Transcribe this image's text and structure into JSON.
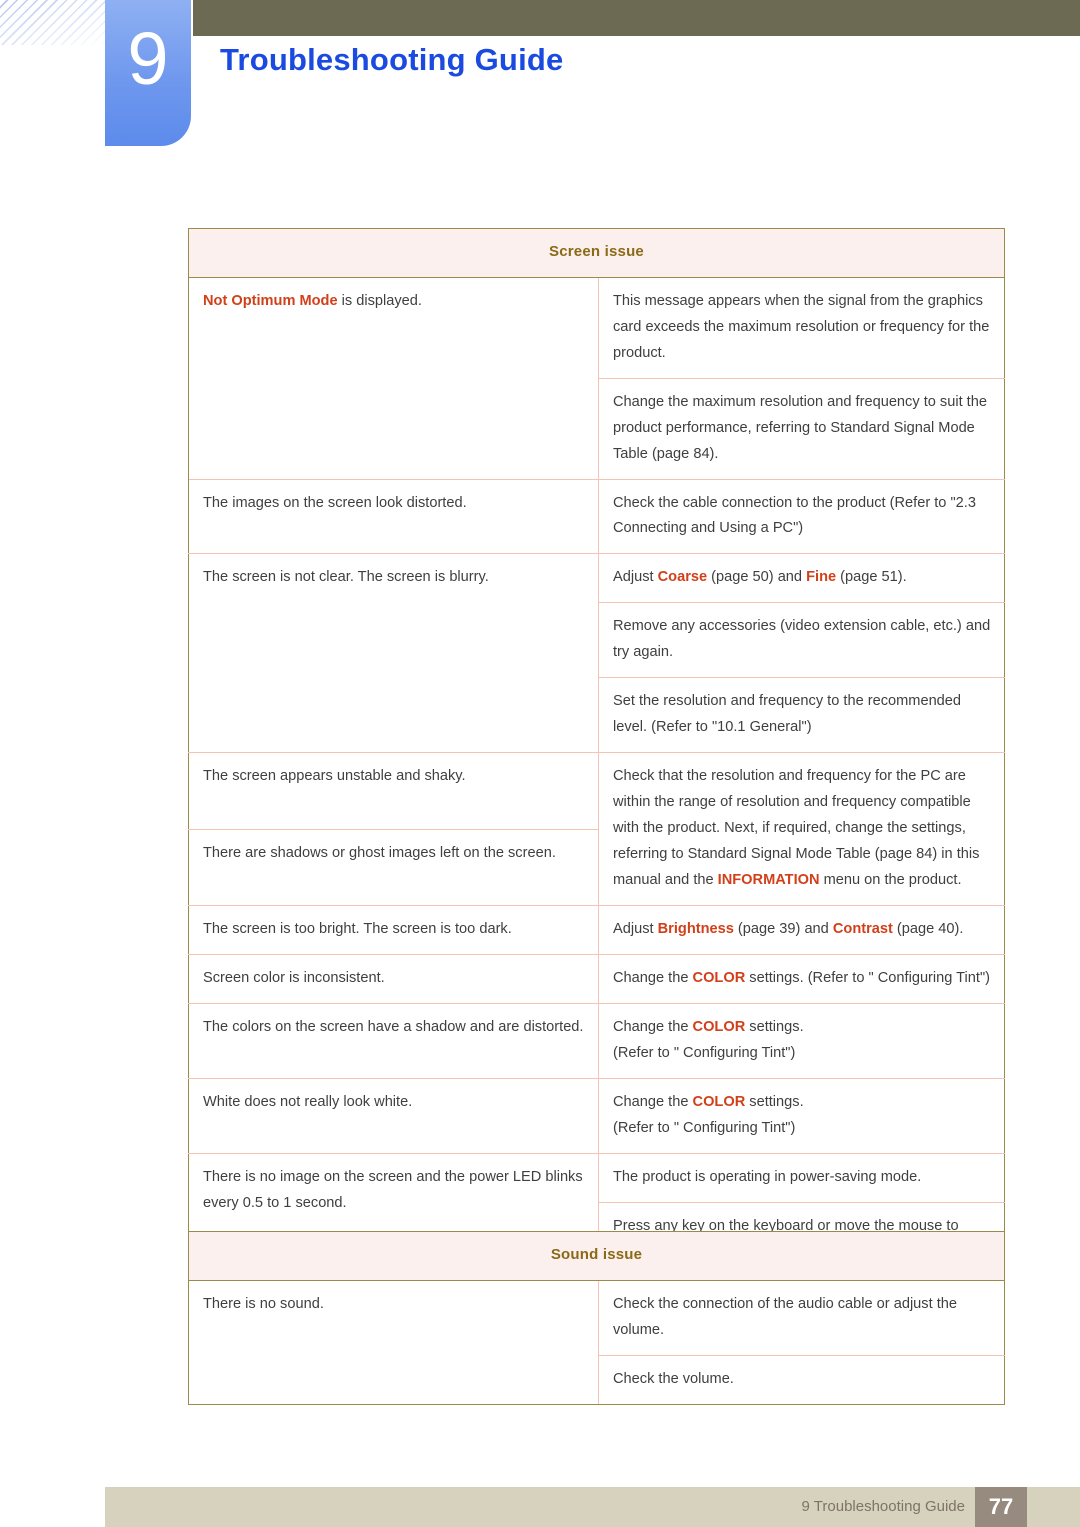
{
  "header": {
    "chapter_number": "9",
    "chapter_title": "Troubleshooting Guide"
  },
  "footer": {
    "label": "9 Troubleshooting Guide",
    "page_number": "77"
  },
  "colors": {
    "accent_blue": "#1b4ae0",
    "badge_blue": "#6f98ee",
    "olive_bar": "#6c6a53",
    "keyword_orange": "#d2401a",
    "section_head_text": "#8a6a16",
    "section_head_bg": "#fcf0ee",
    "table_border": "#f3c3b4",
    "table_frame": "#9a8a4e",
    "footer_bar": "#d7d2be",
    "page_box": "#978b80"
  },
  "screen_table": {
    "section_title": "Screen issue",
    "rows": [
      {
        "symptom": "Not Optimum Mode is displayed.",
        "symptom_kw": "Not Optimum Mode",
        "solutions": [
          "This message appears when the signal from the graphics card exceeds the maximum resolution or frequency for the product.",
          "Change the maximum resolution and frequency to suit the product performance, referring to Standard Signal Mode Table (page 84)."
        ]
      },
      {
        "symptom": "The images on the screen look distorted.",
        "solutions": [
          "Check the cable connection to the product (Refer to \"2.3 Connecting and Using a PC\")"
        ]
      },
      {
        "symptom": "The screen is not clear. The screen is blurry.",
        "solutions": [
          "Adjust Coarse (page 50) and Fine (page 51).",
          "Remove any accessories (video extension cable, etc.) and try again.",
          "Set the resolution and frequency to the recommended level. (Refer to \"10.1 General\")"
        ],
        "solution_kws": [
          "Coarse",
          "Fine"
        ]
      },
      {
        "symptom": "The screen appears unstable and shaky.",
        "symptom2": "There are shadows or ghost images left on the screen.",
        "solutions": [
          "Check that the resolution and frequency for the PC are within the range of resolution and frequency compatible with the product. Next, if required, change the settings, referring to Standard Signal Mode Table (page 84) in this manual and the INFORMATION menu on the product."
        ],
        "solution_kws": [
          "INFORMATION"
        ]
      },
      {
        "symptom": "The screen is too bright. The screen is too dark.",
        "solutions": [
          "Adjust Brightness (page 39) and Contrast (page 40)."
        ],
        "solution_kws": [
          "Brightness",
          "Contrast"
        ]
      },
      {
        "symptom": "Screen color is inconsistent.",
        "solutions": [
          "Change the COLOR settings. (Refer to \" Configuring Tint\")"
        ],
        "solution_kws": [
          "COLOR"
        ]
      },
      {
        "symptom": "The colors on the screen have a shadow and are distorted.",
        "solutions": [
          "Change the COLOR settings.",
          "(Refer to \" Configuring Tint\")"
        ],
        "solution_kws": [
          "COLOR"
        ]
      },
      {
        "symptom": "White does not really look white.",
        "solutions": [
          "Change the COLOR settings.",
          "(Refer to \" Configuring Tint\")"
        ],
        "solution_kws": [
          "COLOR"
        ]
      },
      {
        "symptom": "There is no image on the screen and the power LED blinks every 0.5 to 1 second.",
        "solutions": [
          "The product is operating in power-saving mode.",
          "Press any key on the keyboard or move the mouse to return to normal operating mode."
        ]
      }
    ]
  },
  "sound_table": {
    "section_title": "Sound issue",
    "rows": [
      {
        "symptom": "There is no sound.",
        "solutions": [
          "Check the connection of the audio cable or adjust the volume.",
          "Check the volume."
        ]
      }
    ]
  },
  "text": {
    "r1c1_a": "Not Optimum Mode",
    "r1c1_b": " is displayed.",
    "r1s1": "This message appears when the signal from the graphics card exceeds the maximum resolution or frequency for the product.",
    "r1s2": "Change the maximum resolution and frequency to suit the product performance, referring to Standard Signal Mode Table (page 84).",
    "r2c1": "The images on the screen look distorted.",
    "r2s1": "Check the cable connection to the product (Refer to \"2.3 Connecting and Using a PC\")",
    "r3c1": "The screen is not clear. The screen is blurry.",
    "r3s1_a": "Adjust ",
    "r3s1_kw1": "Coarse",
    "r3s1_b": " (page 50) and ",
    "r3s1_kw2": "Fine",
    "r3s1_c": " (page 51).",
    "r3s2": "Remove any accessories (video extension cable, etc.) and try again.",
    "r3s3": "Set the resolution and frequency to the recommended level. (Refer to \"10.1 General\")",
    "r4c1": "The screen appears unstable and shaky.",
    "r4c1b": "There are shadows or ghost images left on the screen.",
    "r4s1_a": "Check that the resolution and frequency for the PC are within the range of resolution and frequency compatible with the product. Next, if required, change the settings, referring to Standard Signal Mode Table (page 84) in this manual and the ",
    "r4s1_kw": "INFORMATION",
    "r4s1_b": " menu on the product.",
    "r5c1": "The screen is too bright. The screen is too dark.",
    "r5s1_a": "Adjust ",
    "r5s1_kw1": "Brightness",
    "r5s1_b": " (page 39) and ",
    "r5s1_kw2": "Contrast",
    "r5s1_c": " (page 40).",
    "r6c1": "Screen color is inconsistent.",
    "r6s1_a": "Change the ",
    "r6s1_kw": "COLOR",
    "r6s1_b": " settings. (Refer to \" Configuring Tint\")",
    "r7c1": "The colors on the screen have a shadow and are distorted.",
    "r7s1_a": "Change the ",
    "r7s1_kw": "COLOR",
    "r7s1_b": " settings.",
    "r7s1_c": "(Refer to \" Configuring Tint\")",
    "r8c1": "White does not really look white.",
    "r8s1_a": "Change the ",
    "r8s1_kw": "COLOR",
    "r8s1_b": " settings.",
    "r8s1_c": "(Refer to \" Configuring Tint\")",
    "r9c1": "There is no image on the screen and the power LED blinks every 0.5 to 1 second.",
    "r9s1": "The product is operating in power-saving mode.",
    "r9s2": "Press any key on the keyboard or move the mouse to return to normal operating mode.",
    "s1c1": "There is no sound.",
    "s1s1": "Check the connection of the audio cable or adjust the volume.",
    "s1s2": "Check the volume."
  }
}
